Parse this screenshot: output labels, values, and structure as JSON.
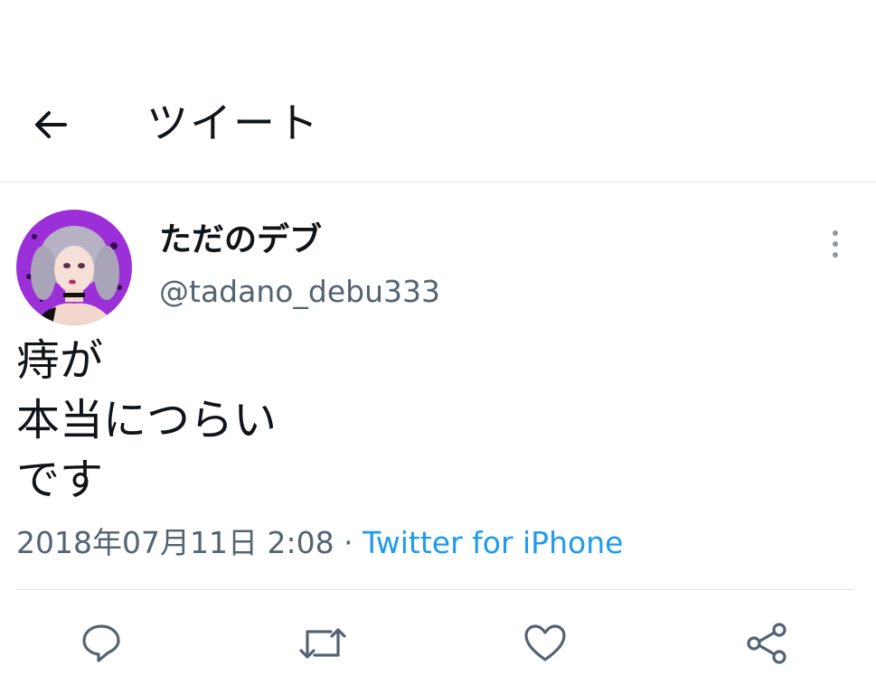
{
  "header": {
    "title": "ツイート",
    "back_icon": "arrow-left-icon"
  },
  "tweet": {
    "display_name": "ただのデブ",
    "handle": "@tadano_debu333",
    "text_lines": [
      "痔が",
      "本当につらい",
      "です"
    ],
    "date": "2018年07月11日 2:08",
    "separator": "·",
    "source": "Twitter for iPhone"
  },
  "actions": {
    "icons": [
      "reply-icon",
      "retweet-icon",
      "like-icon",
      "share-icon"
    ]
  },
  "colors": {
    "text": "#0f1419",
    "secondary": "#536471",
    "link": "#1d9bf0",
    "divider": "#dfe3e6",
    "avatar_bg": "#9b30d9"
  }
}
